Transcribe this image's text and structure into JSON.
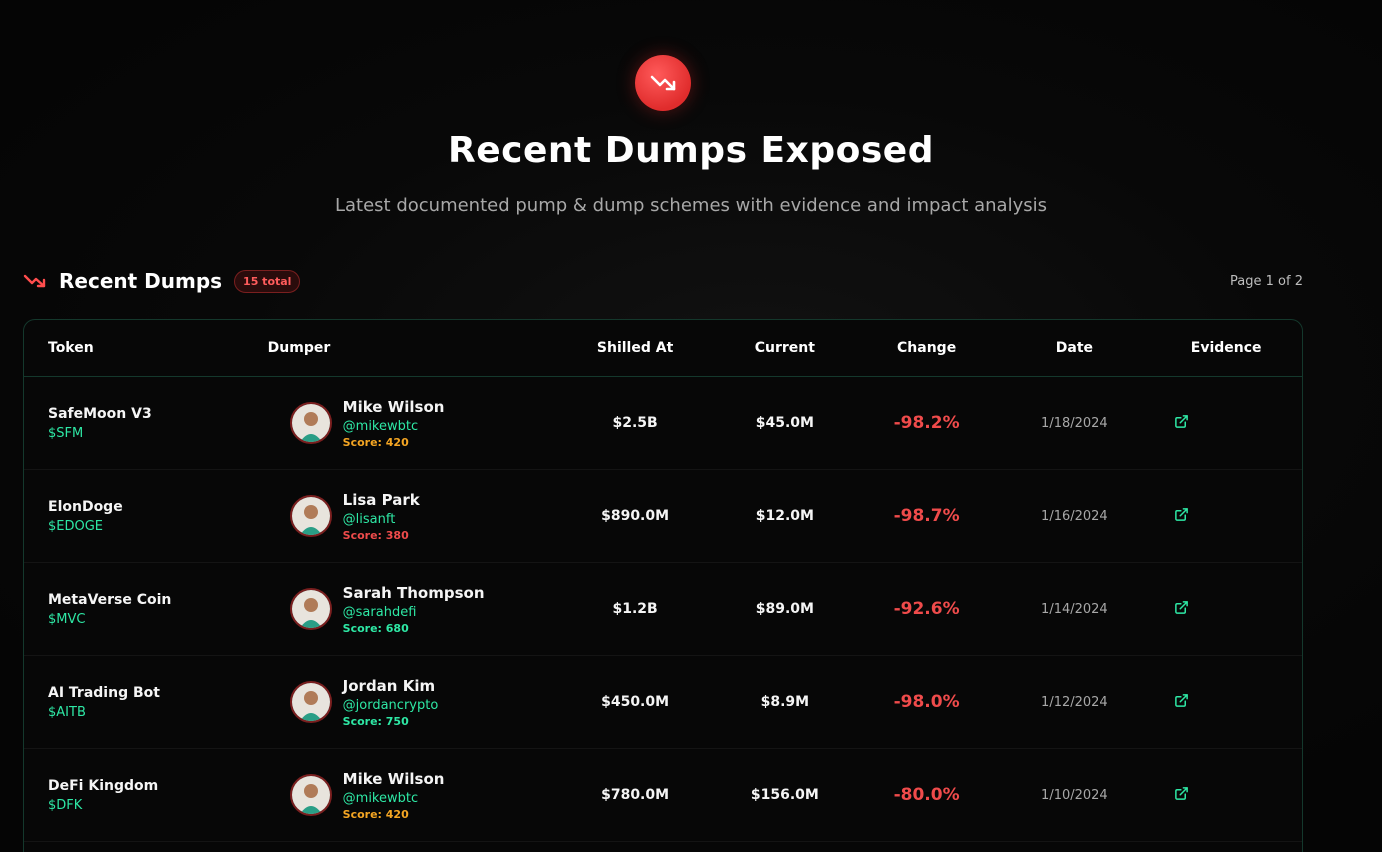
{
  "hero": {
    "title": "Recent Dumps Exposed",
    "subtitle": "Latest documented pump & dump schemes with evidence and impact analysis",
    "icon": "trending-down-icon"
  },
  "section": {
    "title": "Recent Dumps",
    "total_badge": "15 total",
    "page_info": "Page 1 of 2"
  },
  "table": {
    "headers": {
      "token": "Token",
      "dumper": "Dumper",
      "shilled": "Shilled At",
      "current": "Current",
      "change": "Change",
      "date": "Date",
      "evidence": "Evidence"
    },
    "rows": [
      {
        "token": "SafeMoon V3",
        "symbol": "$SFM",
        "dumper": "Mike Wilson",
        "handle": "@mikewbtc",
        "score": "Score: 420",
        "score_color": "#f5a623",
        "shilled": "$2.5B",
        "current": "$45.0M",
        "change": "-98.2%",
        "date": "1/18/2024"
      },
      {
        "token": "ElonDoge",
        "symbol": "$EDOGE",
        "dumper": "Lisa Park",
        "handle": "@lisanft",
        "score": "Score: 380",
        "score_color": "#ef4b4b",
        "shilled": "$890.0M",
        "current": "$12.0M",
        "change": "-98.7%",
        "date": "1/16/2024"
      },
      {
        "token": "MetaVerse Coin",
        "symbol": "$MVC",
        "dumper": "Sarah Thompson",
        "handle": "@sarahdefi",
        "score": "Score: 680",
        "score_color": "#2ee8a5",
        "shilled": "$1.2B",
        "current": "$89.0M",
        "change": "-92.6%",
        "date": "1/14/2024"
      },
      {
        "token": "AI Trading Bot",
        "symbol": "$AITB",
        "dumper": "Jordan Kim",
        "handle": "@jordancrypto",
        "score": "Score: 750",
        "score_color": "#2ee8a5",
        "shilled": "$450.0M",
        "current": "$8.9M",
        "change": "-98.0%",
        "date": "1/12/2024"
      },
      {
        "token": "DeFi Kingdom",
        "symbol": "$DFK",
        "dumper": "Mike Wilson",
        "handle": "@mikewbtc",
        "score": "Score: 420",
        "score_color": "#f5a623",
        "shilled": "$780.0M",
        "current": "$156.0M",
        "change": "-80.0%",
        "date": "1/10/2024"
      }
    ]
  },
  "colors": {
    "accent_green": "#2ee8a5",
    "accent_red": "#ef4b4b",
    "accent_orange": "#f5a623"
  }
}
